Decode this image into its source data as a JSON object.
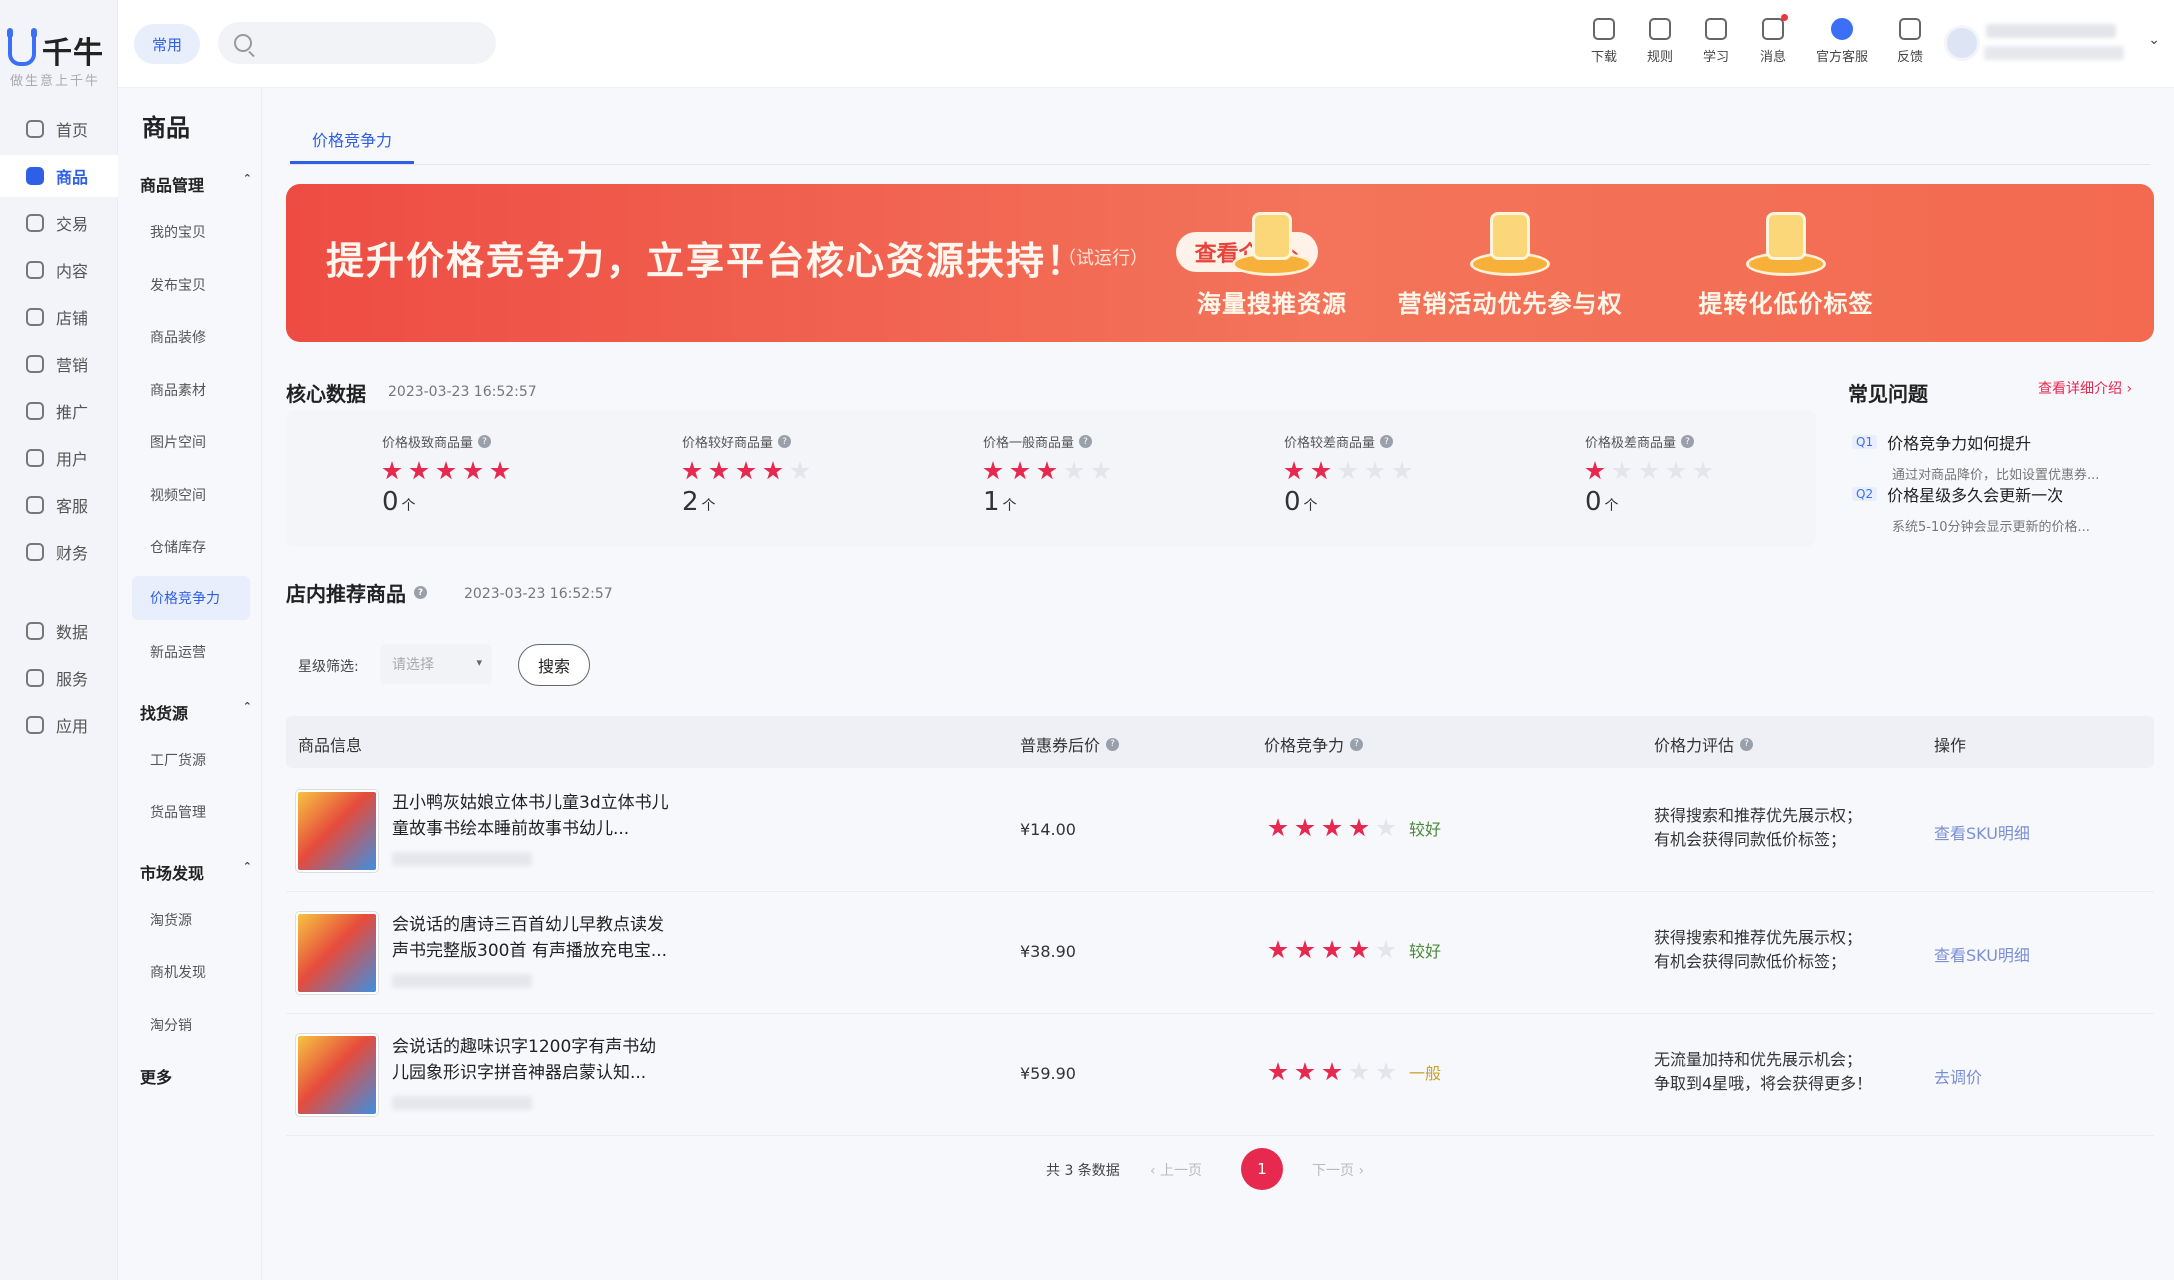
{
  "app": {
    "brand": "千牛",
    "slogan": "做生意上千牛"
  },
  "rail": {
    "items": [
      {
        "label": "首页",
        "icon": "home-icon"
      },
      {
        "label": "商品",
        "icon": "goods-icon",
        "active": true
      },
      {
        "label": "交易",
        "icon": "trade-icon"
      },
      {
        "label": "内容",
        "icon": "content-icon"
      },
      {
        "label": "店铺",
        "icon": "store-icon"
      },
      {
        "label": "营销",
        "icon": "megaphone-icon"
      },
      {
        "label": "推广",
        "icon": "location-icon"
      },
      {
        "label": "用户",
        "icon": "user-icon"
      },
      {
        "label": "客服",
        "icon": "service-icon"
      },
      {
        "label": "财务",
        "icon": "finance-icon"
      },
      {
        "label": "数据",
        "icon": "chart-icon"
      },
      {
        "label": "服务",
        "icon": "grid-icon"
      },
      {
        "label": "应用",
        "icon": "app-icon"
      }
    ]
  },
  "subnav": {
    "title": "商品",
    "groups": [
      {
        "label": "商品管理",
        "items": [
          "我的宝贝",
          "发布宝贝",
          "商品装修",
          "商品素材",
          "图片空间",
          "视频空间",
          "仓储库存",
          "价格竞争力",
          "新品运营"
        ]
      },
      {
        "label": "找货源",
        "items": [
          "工厂货源",
          "货品管理"
        ]
      },
      {
        "label": "市场发现",
        "items": [
          "淘货源",
          "商机发现",
          "淘分销"
        ]
      }
    ],
    "more": "更多",
    "active": "价格竞争力"
  },
  "topbar": {
    "chip": "常用",
    "search_placeholder": "",
    "tools": [
      {
        "label": "下载",
        "icon": "download-icon"
      },
      {
        "label": "规则",
        "icon": "rules-icon"
      },
      {
        "label": "学习",
        "icon": "learn-icon"
      },
      {
        "label": "消息",
        "icon": "message-icon",
        "dot": true
      },
      {
        "label": "官方客服",
        "icon": "official-service-icon"
      },
      {
        "label": "反馈",
        "icon": "feedback-icon"
      }
    ]
  },
  "tab": {
    "label": "价格竞争力"
  },
  "banner": {
    "title": "提升价格竞争力，立享平台核心资源扶持！",
    "tag": "（试运行）",
    "button": "查看介绍 ›",
    "features": [
      "海量搜推资源",
      "营销活动优先参与权",
      "提转化低价标签"
    ],
    "colors": {
      "start": "#ee4c43",
      "end": "#f36a50"
    }
  },
  "core": {
    "title": "核心数据",
    "time": "2023-03-23 16:52:57",
    "metrics": [
      {
        "label": "价格极致商品量",
        "stars": 5,
        "value": "0",
        "unit": "个"
      },
      {
        "label": "价格较好商品量",
        "stars": 4,
        "value": "2",
        "unit": "个"
      },
      {
        "label": "价格一般商品量",
        "stars": 3,
        "value": "1",
        "unit": "个"
      },
      {
        "label": "价格较差商品量",
        "stars": 2,
        "value": "0",
        "unit": "个"
      },
      {
        "label": "价格极差商品量",
        "stars": 1,
        "value": "0",
        "unit": "个"
      }
    ]
  },
  "faq": {
    "title": "常见问题",
    "link": "查看详细介绍 ›",
    "items": [
      {
        "tag": "Q1",
        "question": "价格竞争力如何提升",
        "answer": "通过对商品降价，比如设置优惠券..."
      },
      {
        "tag": "Q2",
        "question": "价格星级多久会更新一次",
        "answer": "系统5-10分钟会显示更新的价格..."
      }
    ]
  },
  "recommend": {
    "title": "店内推荐商品",
    "time": "2023-03-23 16:52:57"
  },
  "filter": {
    "label": "星级筛选:",
    "placeholder": "请选择",
    "button": "搜索"
  },
  "table": {
    "headers": [
      "商品信息",
      "普惠券后价",
      "价格竞争力",
      "价格力评估",
      "操作"
    ],
    "rows": [
      {
        "name": "丑小鸭灰姑娘立体书儿童3d立体书儿童故事书绘本睡前故事书幼儿...",
        "price": "¥14.00",
        "stars": 4,
        "level": "较好",
        "eval": [
          "获得搜索和推荐优先展示权；",
          "有机会获得同款低价标签；"
        ],
        "op": "查看SKU明细"
      },
      {
        "name": "会说话的唐诗三百首幼儿早教点读发声书完整版300首 有声播放充电宝...",
        "price": "¥38.90",
        "stars": 4,
        "level": "较好",
        "eval": [
          "获得搜索和推荐优先展示权；",
          "有机会获得同款低价标签；"
        ],
        "op": "查看SKU明细"
      },
      {
        "name": "会说话的趣味识字1200字有声书幼儿园象形识字拼音神器启蒙认知...",
        "price": "¥59.90",
        "stars": 3,
        "level": "一般",
        "eval": [
          "无流量加持和优先展示机会；",
          "争取到4星哦，将会获得更多！"
        ],
        "op": "去调价"
      }
    ]
  },
  "pagination": {
    "total": "共 3 条数据",
    "prev": "‹ 上一页",
    "current": "1",
    "next": "下一页 ›"
  },
  "colors": {
    "accent": "#2f5fe6",
    "star": "#e8294f",
    "good": "#4a8a3a",
    "normal": "#c9a227"
  }
}
